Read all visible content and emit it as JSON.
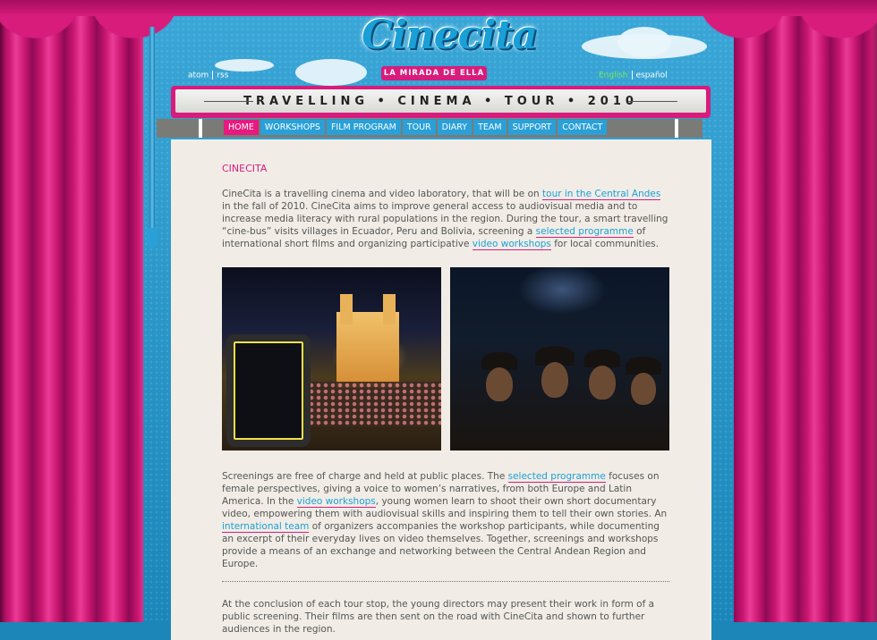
{
  "logo": {
    "word": "Cinecita",
    "tagline": "LA MIRADA DE ELLA"
  },
  "feeds": {
    "atom": "atom",
    "rss": "rss"
  },
  "languages": {
    "english": "English",
    "spanish": "español"
  },
  "marquee": "TRAVELLING • CINEMA • TOUR • 2010",
  "nav": [
    "HOME",
    "WORKSHOPS",
    "FILM PROGRAM",
    "TOUR",
    "DIARY",
    "TEAM",
    "SUPPORT",
    "CONTACT"
  ],
  "content": {
    "title": "CINECITA",
    "intro": {
      "t1": "CineCita is a travelling cinema and video laboratory, that will be on ",
      "l1": "tour in the Central Andes",
      "t2": " in the fall of 2010. CineCita aims to improve general access to audiovisual media and to increase media literacy with rural populations in the region. During the tour, a smart travelling “cine-bus” visits villages in Ecuador, Peru and Bolivia, screening a ",
      "l2": "selected programme",
      "t3": " of international short films and organizing participative ",
      "l3": "video workshops",
      "t4": " for local communities."
    },
    "second": {
      "t1": "Screenings are free of charge and held at public places. The ",
      "l1": "selected programme",
      "t2": " focuses on female perspectives, giving a voice to women’s narratives, from both Europe and Latin America. In the ",
      "l2": "video workshops",
      "t3": ", young women learn to shoot their own short documentary video, empowering them with audiovisual skills and inspiring them to tell their own stories. An ",
      "l3": "international team",
      "t4": " of organizers accompanies the workshop participants, while documenting an excerpt of their everyday lives on video themselves. Together, screenings and workshops provide a means of an exchange and networking between the Central Andean Region and Europe."
    },
    "third": "At the conclusion of each tour stop, the young directors may present their work in form of a public screening. Their films are then sent on the road with CineCita and shown to further audiences in the region."
  }
}
